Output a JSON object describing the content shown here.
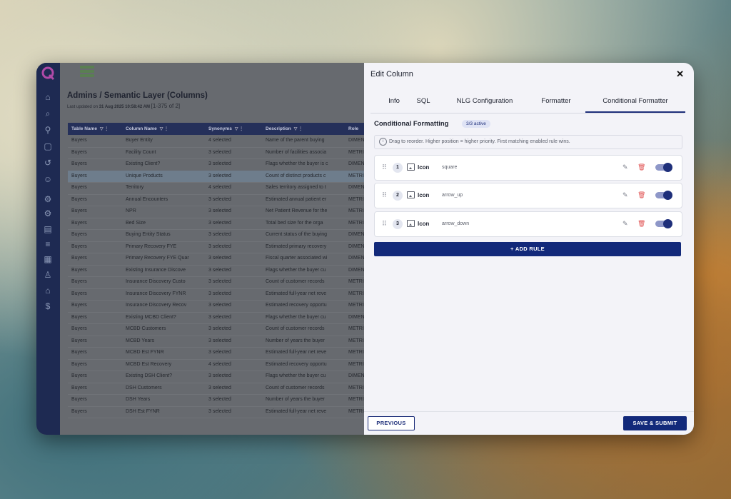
{
  "app": {
    "page_title": "Admins / Semantic Layer (Columns)",
    "last_updated_prefix": "Last updated on",
    "last_updated": "31 Aug 2025 10:58:42 AM",
    "range": "[1-375 of 2]"
  },
  "table": {
    "headers": [
      "Table Name",
      "Column Name",
      "Synonyms",
      "Description",
      "Role"
    ],
    "rows": [
      [
        "Buyers",
        "Buyer Entity",
        "4 selected",
        "Name of the parent buying",
        "DIMEN"
      ],
      [
        "Buyers",
        "Facility Count",
        "3 selected",
        "Number of facilities associa",
        "METRI"
      ],
      [
        "Buyers",
        "Existing Client?",
        "3 selected",
        "Flags whether the buyer is c",
        "DIMEN"
      ],
      [
        "Buyers",
        "Unique Products",
        "3 selected",
        "Count of distinct products c",
        "METRI"
      ],
      [
        "Buyers",
        "Territory",
        "4 selected",
        "Sales territory assigned to t",
        "DIMEN"
      ],
      [
        "Buyers",
        "Annual Encounters",
        "3 selected",
        "Estimated annual patient er",
        "METRI"
      ],
      [
        "Buyers",
        "NPR",
        "3 selected",
        "Net Patient Revenue for the",
        "METRI"
      ],
      [
        "Buyers",
        "Bed Size",
        "3 selected",
        "Total bed size for the orga",
        "METRI"
      ],
      [
        "Buyers",
        "Buying Entity Status",
        "3 selected",
        "Current status of the buying",
        "DIMEN"
      ],
      [
        "Buyers",
        "Primary Recovery FYE",
        "3 selected",
        "Estimated primary recovery",
        "DIMEN"
      ],
      [
        "Buyers",
        "Primary Recovery FYE Quar",
        "3 selected",
        "Fiscal quarter associated wi",
        "DIMEN"
      ],
      [
        "Buyers",
        "Existing Insurance Discove",
        "3 selected",
        "Flags whether the buyer cu",
        "DIMEN"
      ],
      [
        "Buyers",
        "Insurance Discovery Custo",
        "3 selected",
        "Count of customer records",
        "METRI"
      ],
      [
        "Buyers",
        "Insurance Discovery FYNR",
        "3 selected",
        "Estimated full-year net reve",
        "METRI"
      ],
      [
        "Buyers",
        "Insurance Discovery Recov",
        "3 selected",
        "Estimated recovery opportu",
        "METRI"
      ],
      [
        "Buyers",
        "Existing MCBD Client?",
        "3 selected",
        "Flags whether the buyer cu",
        "DIMEN"
      ],
      [
        "Buyers",
        "MCBD Customers",
        "3 selected",
        "Count of customer records",
        "METRI"
      ],
      [
        "Buyers",
        "MCBD Years",
        "3 selected",
        "Number of years the buyer",
        "METRI"
      ],
      [
        "Buyers",
        "MCBD Est FYNR",
        "3 selected",
        "Estimated full-year net reve",
        "METRI"
      ],
      [
        "Buyers",
        "MCBD Est Recovery",
        "4 selected",
        "Estimated recovery opportu",
        "METRI"
      ],
      [
        "Buyers",
        "Existing DSH Client?",
        "3 selected",
        "Flags whether the buyer cu",
        "DIMEN"
      ],
      [
        "Buyers",
        "DSH Customers",
        "3 selected",
        "Count of customer records",
        "METRI"
      ],
      [
        "Buyers",
        "DSH Years",
        "3 selected",
        "Number of years the buyer",
        "METRI"
      ],
      [
        "Buyers",
        "DSH Est FYNR",
        "3 selected",
        "Estimated full-year net reve",
        "METRI"
      ]
    ]
  },
  "modal": {
    "title": "Edit Column",
    "close": "✕",
    "tabs": [
      "Info",
      "SQL",
      "NLG Configuration",
      "Formatter",
      "Conditional Formatter"
    ],
    "section_title": "Conditional Formatting",
    "badge": "3/3 active",
    "info_text": "Drag to reorder. Higher position = higher priority. First matching enabled rule wins.",
    "rules": [
      {
        "num": "1",
        "type": "Icon",
        "value": "square"
      },
      {
        "num": "2",
        "type": "Icon",
        "value": "arrow_up"
      },
      {
        "num": "3",
        "type": "Icon",
        "value": "arrow_down"
      }
    ],
    "add_rule": "+  ADD RULE",
    "previous": "PREVIOUS",
    "save": "SAVE & SUBMIT"
  },
  "colors": {
    "primary": "#12297a",
    "nav_bg": "#1e2a52",
    "danger": "#e05050"
  }
}
